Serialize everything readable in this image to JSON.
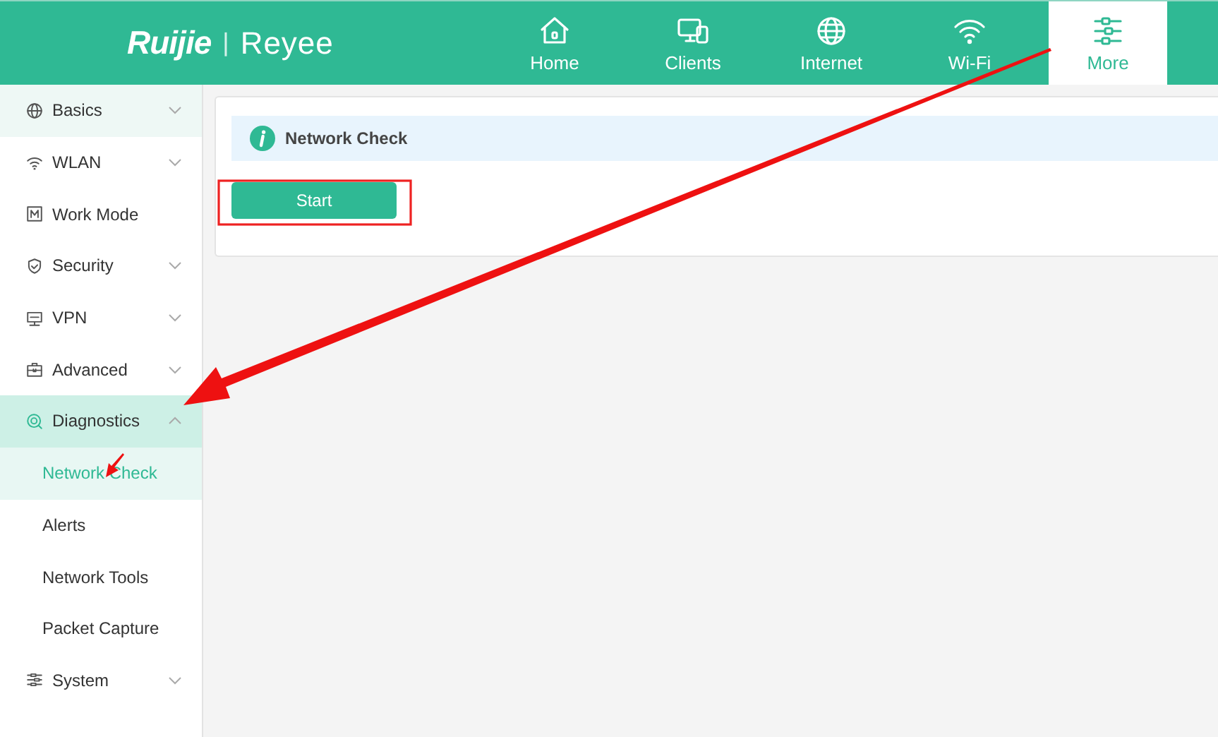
{
  "header": {
    "logo": {
      "brand": "Ruijie",
      "divider": "|",
      "product": "Reyee"
    },
    "tabs": [
      {
        "label": "Home",
        "selected": false
      },
      {
        "label": "Clients",
        "selected": false
      },
      {
        "label": "Internet",
        "selected": false
      },
      {
        "label": "Wi-Fi",
        "selected": false
      },
      {
        "label": "More",
        "selected": true
      }
    ]
  },
  "sidebar": {
    "items": [
      {
        "label": "Basics",
        "hovered": true,
        "expanded": false
      },
      {
        "label": "WLAN",
        "hovered": false,
        "expanded": false
      },
      {
        "label": "Work Mode",
        "hovered": false
      },
      {
        "label": "Security",
        "hovered": false,
        "expanded": false
      },
      {
        "label": "VPN",
        "hovered": false,
        "expanded": false
      },
      {
        "label": "Advanced",
        "hovered": false,
        "expanded": false
      },
      {
        "label": "Diagnostics",
        "hovered": false,
        "expanded": true,
        "children": [
          {
            "label": "Network Check",
            "selected": true
          },
          {
            "label": "Alerts",
            "selected": false
          },
          {
            "label": "Network Tools",
            "selected": false
          },
          {
            "label": "Packet Capture",
            "selected": false
          }
        ]
      },
      {
        "label": "System",
        "hovered": false,
        "expanded": false
      }
    ]
  },
  "content": {
    "banner": {
      "title": "Network Check"
    },
    "start_button": {
      "label": "Start"
    }
  },
  "annotations": [
    {
      "kind": "highlight-box"
    },
    {
      "kind": "arrow"
    },
    {
      "kind": "small-arrow"
    }
  ]
}
